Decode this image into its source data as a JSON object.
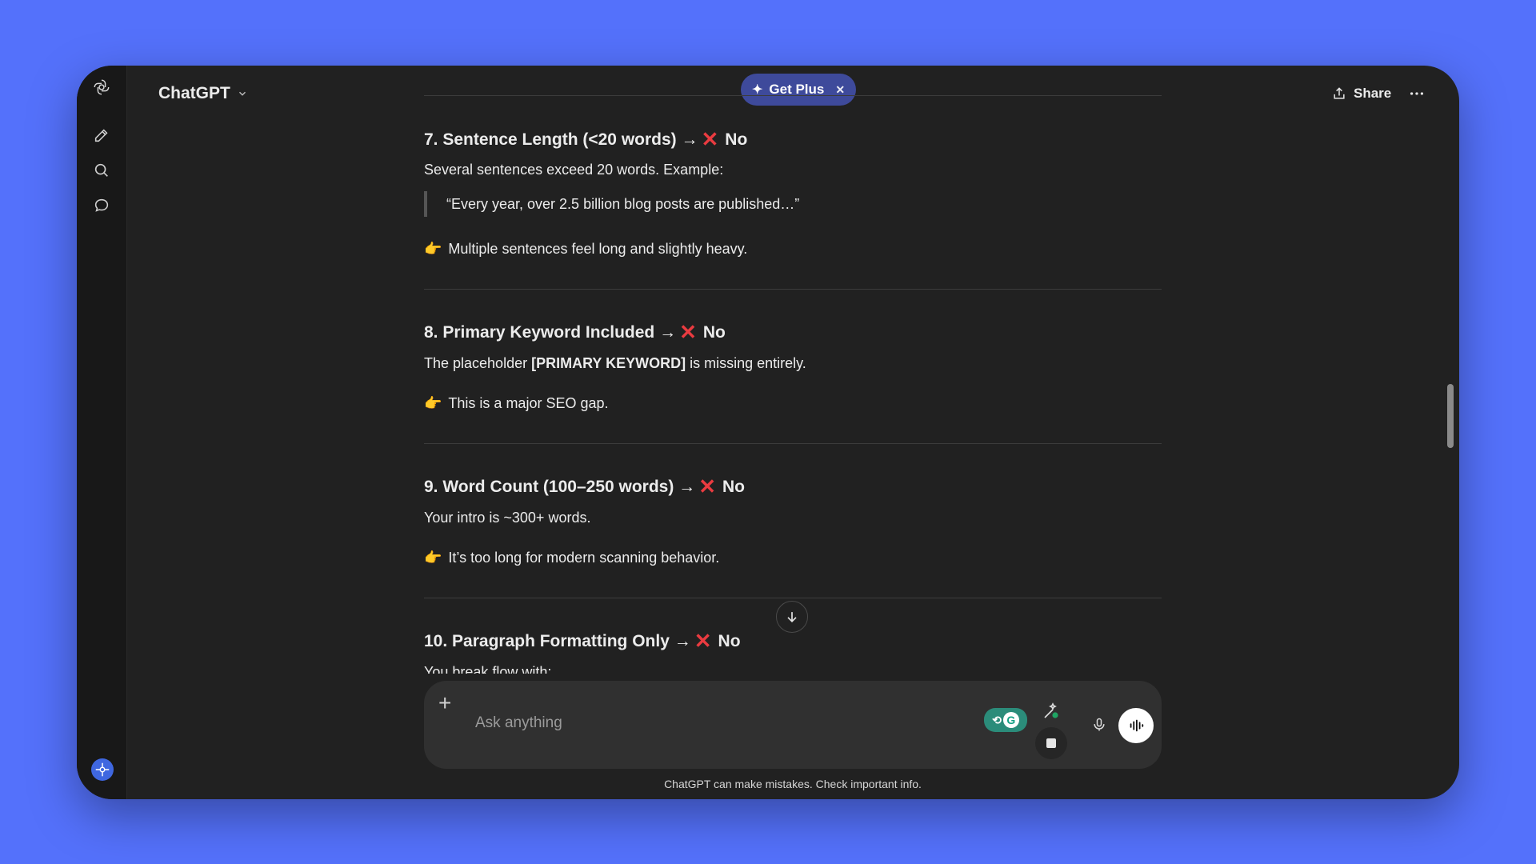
{
  "app": {
    "title": "ChatGPT"
  },
  "header": {
    "get_plus_label": "Get Plus",
    "share_label": "Share"
  },
  "sections": [
    {
      "heading": "7. Sentence Length (<20 words) →",
      "verdict": "No",
      "body": "Several sentences exceed 20 words. Example:",
      "quote": "“Every year, over 2.5 billion blog posts are published…”",
      "note": "Multiple sentences feel long and slightly heavy."
    },
    {
      "heading": "8. Primary Keyword Included →",
      "verdict": "No",
      "body_pre": "The placeholder ",
      "body_bold": "[PRIMARY KEYWORD]",
      "body_post": " is missing entirely.",
      "note": "This is a major SEO gap."
    },
    {
      "heading": "9. Word Count (100–250 words) →",
      "verdict": "No",
      "body": "Your intro is ~300+ words.",
      "note": "It’s too long for modern scanning behavior."
    },
    {
      "heading": "10. Paragraph Formatting Only →",
      "verdict": "No",
      "body": "You break flow with:"
    }
  ],
  "composer": {
    "placeholder": "Ask anything"
  },
  "footer": {
    "disclaimer": "ChatGPT can make mistakes. Check important info."
  },
  "icons": {
    "logo": "openai-logo-icon",
    "new_chat": "edit-icon",
    "search": "search-icon",
    "chats": "chat-bubble-icon",
    "mic": "microphone-icon",
    "voice": "voice-mode-icon"
  },
  "colors": {
    "background": "#5471fb",
    "window": "#212121",
    "accent_cross": "#ea3b40",
    "get_plus": "#3e4a9b"
  }
}
